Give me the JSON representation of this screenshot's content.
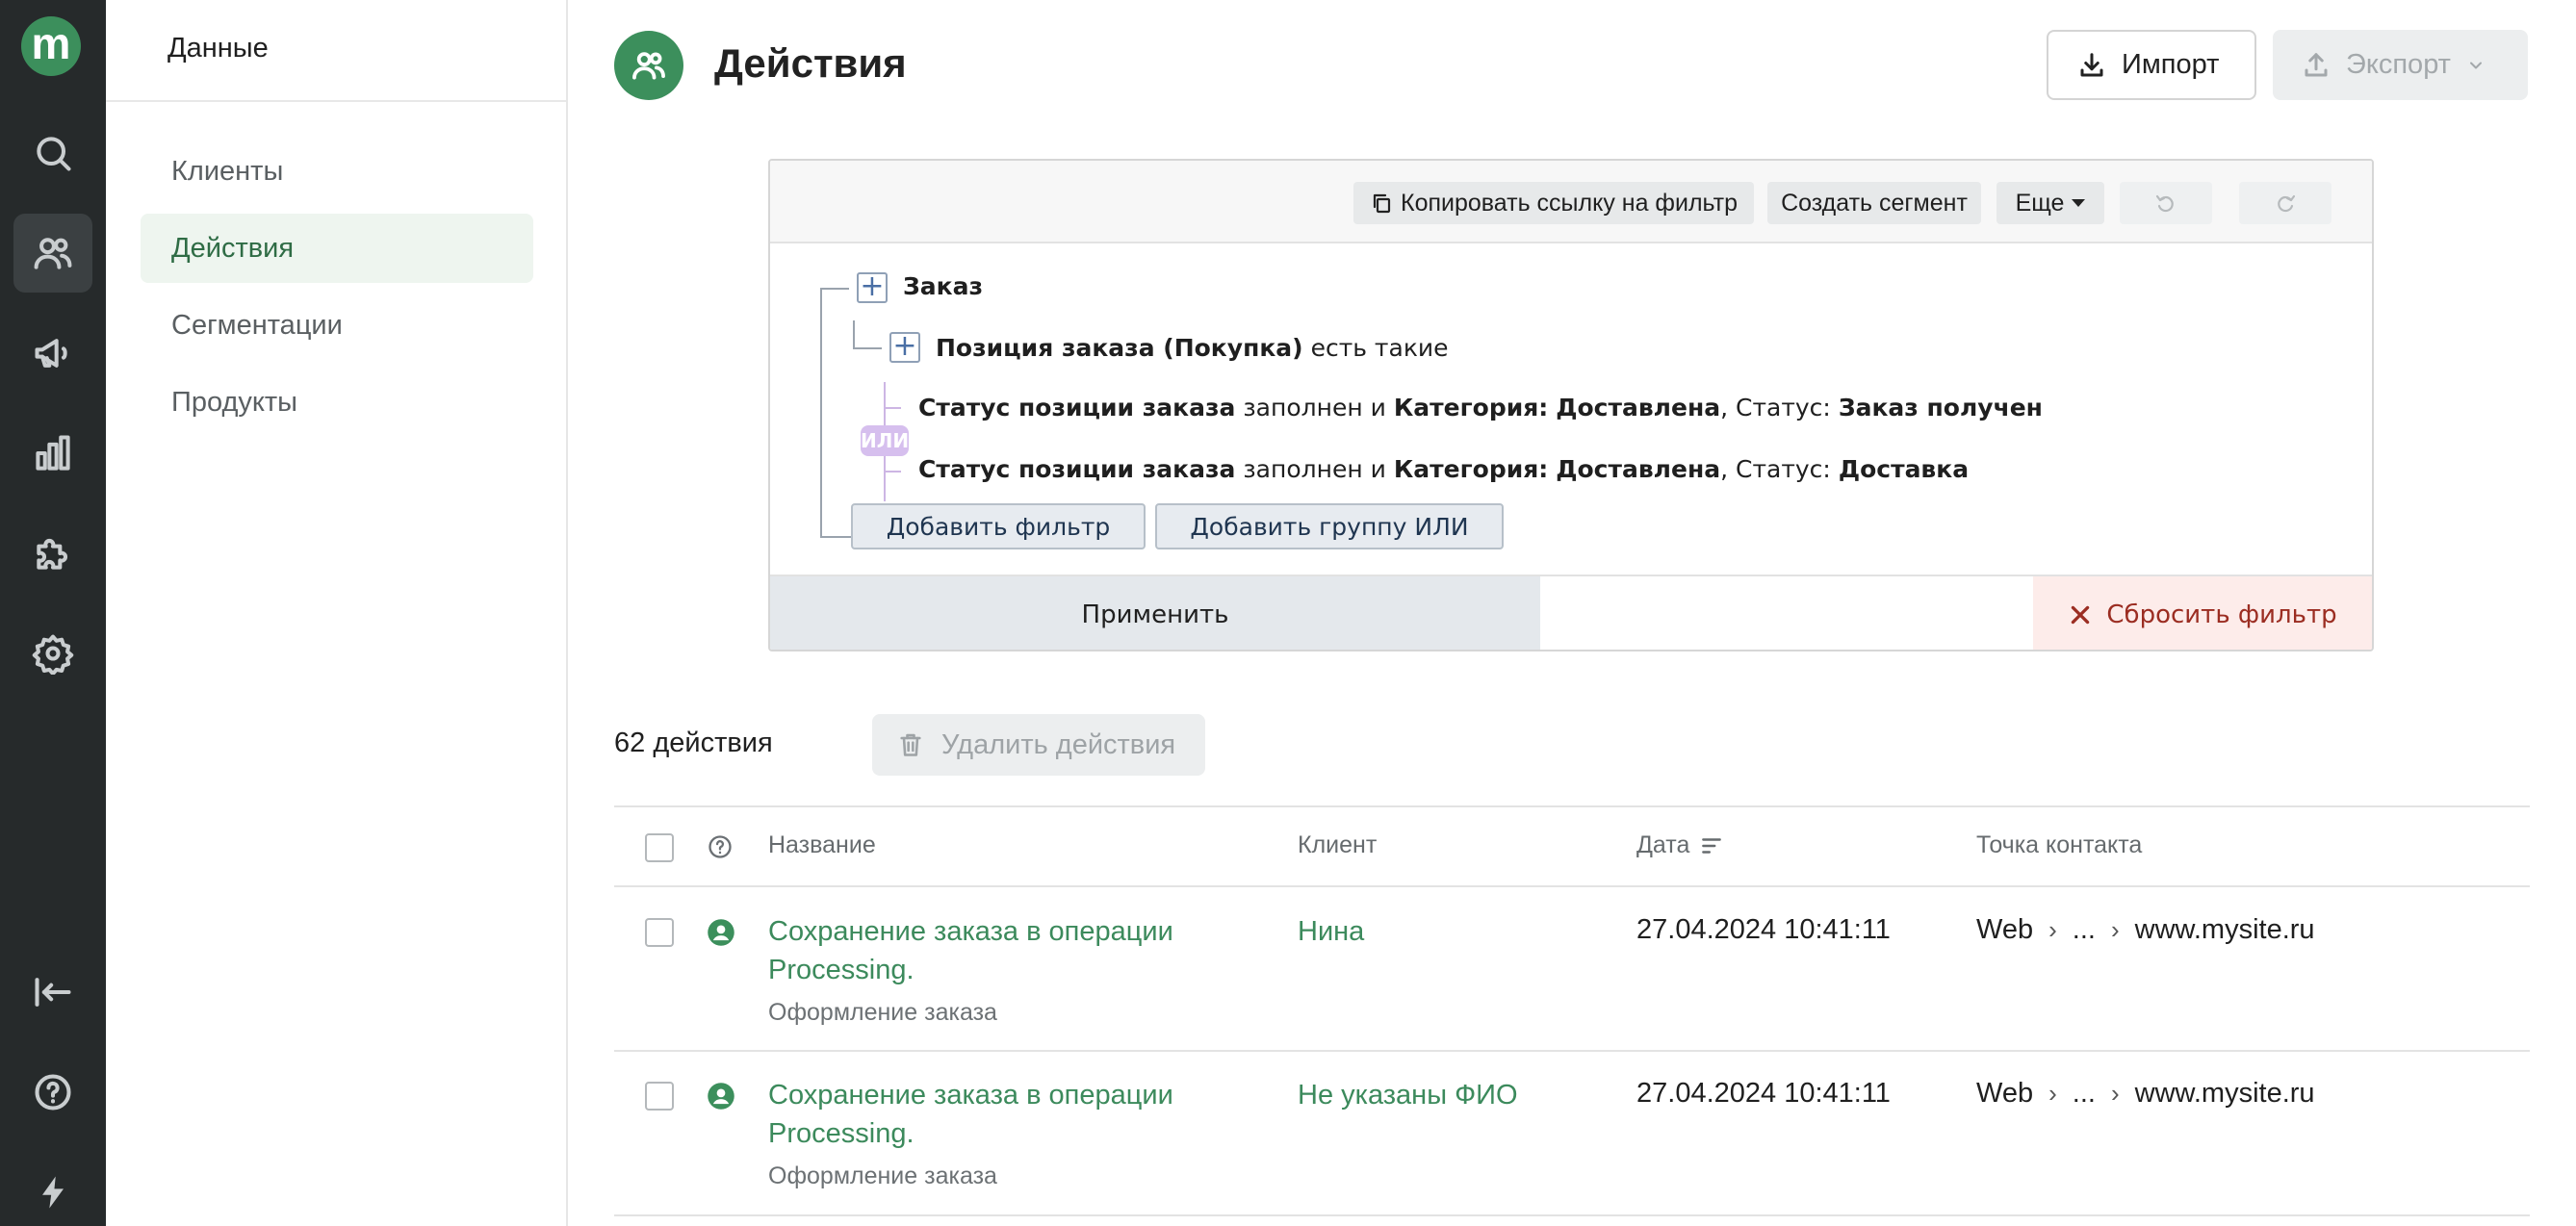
{
  "sidebar": {
    "header": "Данные",
    "items": [
      {
        "label": "Клиенты"
      },
      {
        "label": "Действия",
        "active": true
      },
      {
        "label": "Сегментации"
      },
      {
        "label": "Продукты"
      }
    ]
  },
  "rail": {
    "logo": "m",
    "icons": [
      "search-icon",
      "users-icon",
      "megaphone-icon",
      "chart-icon",
      "puzzle-icon",
      "gear-icon",
      "collapse-icon",
      "help-icon",
      "bolt-icon"
    ]
  },
  "page": {
    "title": "Действия",
    "import_label": "Импорт",
    "export_label": "Экспорт"
  },
  "filter": {
    "copy_link_label": "Копировать ссылку на фильтр",
    "create_segment_label": "Создать сегмент",
    "more_label": "Еще",
    "root_label": "Заказ",
    "child_label": "Позиция заказа (Покупка)",
    "child_suffix": "есть такие",
    "or_label": "ИЛИ",
    "conditions": [
      {
        "field": "Статус позиции заказа",
        "op": "заполнен и",
        "cat_label": "Категория:",
        "cat_value": "Доставлена",
        "status_label": ", Статус:",
        "status_value": "Заказ получен"
      },
      {
        "field": "Статус позиции заказа",
        "op": "заполнен и",
        "cat_label": "Категория:",
        "cat_value": "Доставлена",
        "status_label": ", Статус:",
        "status_value": "Доставка"
      }
    ],
    "add_filter_label": "Добавить фильтр",
    "add_or_group_label": "Добавить группу ИЛИ",
    "apply_label": "Применить",
    "reset_label": "Сбросить фильтр"
  },
  "list": {
    "count_label": "62 действия",
    "delete_label": "Удалить действия",
    "columns": {
      "name": "Название",
      "client": "Клиент",
      "date": "Дата",
      "contact": "Точка контакта"
    },
    "rows": [
      {
        "title": "Сохранение заказа в операции Processing.",
        "subtitle": "Оформление заказа",
        "client": "Нина",
        "date": "27.04.2024 10:41:11",
        "contact": [
          "Web",
          "...",
          "www.mysite.ru"
        ]
      },
      {
        "title": "Сохранение заказа в операции Processing.",
        "subtitle": "Оформление заказа",
        "client": "Не указаны ФИО",
        "date": "27.04.2024 10:41:11",
        "contact": [
          "Web",
          "...",
          "www.mysite.ru"
        ]
      }
    ]
  },
  "colors": {
    "accent": "#3c8f5c",
    "rail_bg": "#262a2b",
    "link": "#3c8a5c",
    "reset_text": "#9b2d22"
  }
}
